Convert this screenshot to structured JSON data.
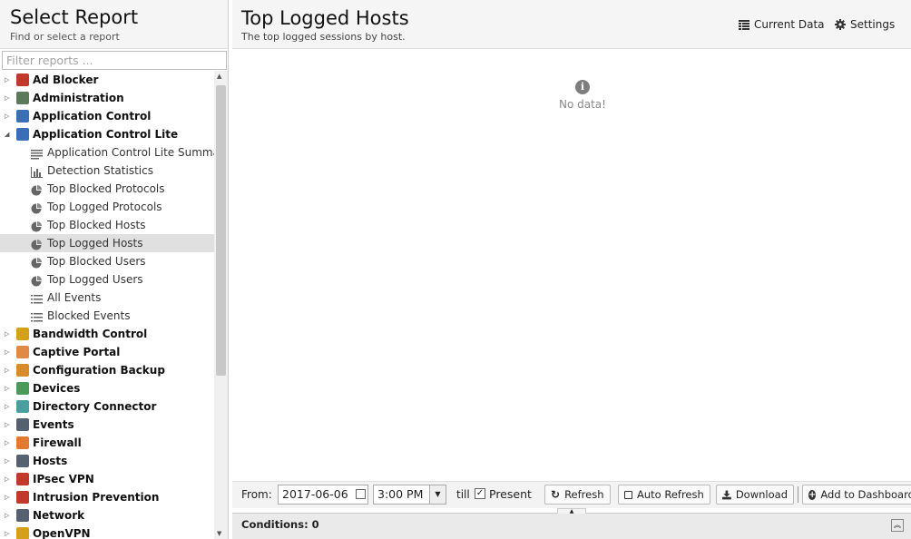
{
  "left": {
    "title": "Select Report",
    "subtitle": "Find or select a report",
    "filter_placeholder": "Filter reports ..."
  },
  "tree": [
    {
      "label": "Ad Blocker",
      "level": 0,
      "arrow": "▷",
      "color": "#c0392b"
    },
    {
      "label": "Administration",
      "level": 0,
      "arrow": "▷",
      "color": "#5a7a5a"
    },
    {
      "label": "Application Control",
      "level": 0,
      "arrow": "▷",
      "color": "#3a6fb5"
    },
    {
      "label": "Application Control Lite",
      "level": 0,
      "arrow": "◢",
      "color": "#3a6fb5"
    },
    {
      "label": "Application Control Lite Summary",
      "level": 1,
      "icon": "text-icon"
    },
    {
      "label": "Detection Statistics",
      "level": 1,
      "icon": "bar-chart-icon"
    },
    {
      "label": "Top Blocked Protocols",
      "level": 1,
      "icon": "pie-chart-icon"
    },
    {
      "label": "Top Logged Protocols",
      "level": 1,
      "icon": "pie-chart-icon"
    },
    {
      "label": "Top Blocked Hosts",
      "level": 1,
      "icon": "pie-chart-icon"
    },
    {
      "label": "Top Logged Hosts",
      "level": 1,
      "icon": "pie-chart-icon",
      "selected": true
    },
    {
      "label": "Top Blocked Users",
      "level": 1,
      "icon": "pie-chart-icon"
    },
    {
      "label": "Top Logged Users",
      "level": 1,
      "icon": "pie-chart-icon"
    },
    {
      "label": "All Events",
      "level": 1,
      "icon": "list-icon"
    },
    {
      "label": "Blocked Events",
      "level": 1,
      "icon": "list-icon"
    },
    {
      "label": "Bandwidth Control",
      "level": 0,
      "arrow": "▷",
      "color": "#d4a017"
    },
    {
      "label": "Captive Portal",
      "level": 0,
      "arrow": "▷",
      "color": "#e08a4a"
    },
    {
      "label": "Configuration Backup",
      "level": 0,
      "arrow": "▷",
      "color": "#d98b2b"
    },
    {
      "label": "Devices",
      "level": 0,
      "arrow": "▷",
      "color": "#4a9a5a"
    },
    {
      "label": "Directory Connector",
      "level": 0,
      "arrow": "▷",
      "color": "#4aa0a0"
    },
    {
      "label": "Events",
      "level": 0,
      "arrow": "▷",
      "color": "#556070"
    },
    {
      "label": "Firewall",
      "level": 0,
      "arrow": "▷",
      "color": "#e07a30"
    },
    {
      "label": "Hosts",
      "level": 0,
      "arrow": "▷",
      "color": "#556070"
    },
    {
      "label": "IPsec VPN",
      "level": 0,
      "arrow": "▷",
      "color": "#c0392b"
    },
    {
      "label": "Intrusion Prevention",
      "level": 0,
      "arrow": "▷",
      "color": "#c0392b"
    },
    {
      "label": "Network",
      "level": 0,
      "arrow": "▷",
      "color": "#556070"
    },
    {
      "label": "OpenVPN",
      "level": 0,
      "arrow": "▷",
      "color": "#d4a017"
    }
  ],
  "report": {
    "title": "Top Logged Hosts",
    "subtitle": "The top logged sessions by host.",
    "current_data": "Current Data",
    "settings": "Settings",
    "no_data": "No data!"
  },
  "toolbar": {
    "from_label": "From:",
    "date": "2017-06-06",
    "time": "3:00 PM",
    "till_label": "till",
    "present_label": "Present",
    "present_checked": true,
    "refresh": "Refresh",
    "auto_refresh": "Auto Refresh",
    "download": "Download",
    "add_dashboard": "Add to Dashboard"
  },
  "conditions": {
    "label": "Conditions: 0"
  }
}
